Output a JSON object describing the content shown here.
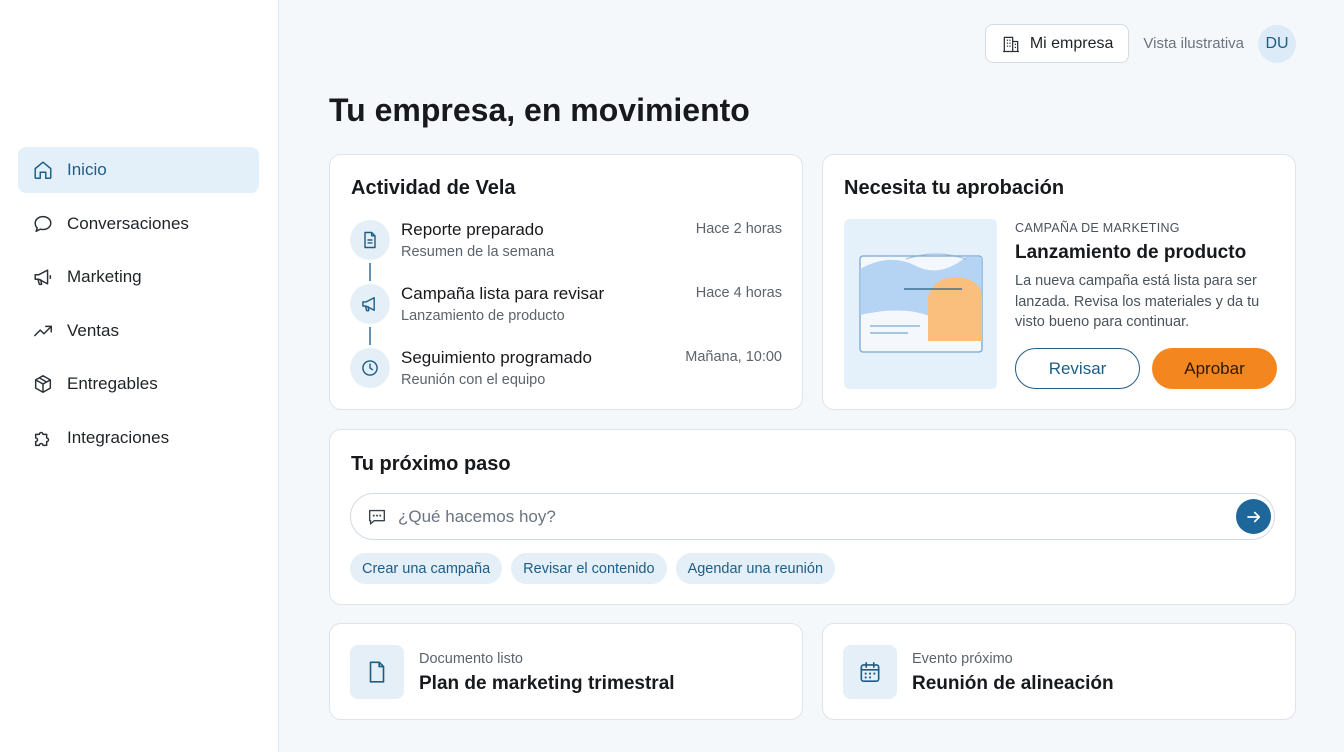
{
  "sidebar": {
    "items": [
      {
        "label": "Inicio",
        "icon": "home-icon",
        "active": true
      },
      {
        "label": "Conversaciones",
        "icon": "chat-bubble-icon"
      },
      {
        "label": "Marketing",
        "icon": "megaphone-icon"
      },
      {
        "label": "Ventas",
        "icon": "trending-up-icon"
      },
      {
        "label": "Entregables",
        "icon": "package-icon"
      },
      {
        "label": "Integraciones",
        "icon": "puzzle-icon"
      }
    ]
  },
  "header": {
    "company_label": "Mi empresa",
    "company_icon": "building-icon",
    "view_label": "Vista ilustrativa",
    "avatar_initials": "DU"
  },
  "page": {
    "title": "Tu empresa, en movimiento"
  },
  "activity": {
    "title": "Actividad de Vela",
    "items": [
      {
        "title": "Reporte preparado",
        "subtitle": "Resumen de la semana",
        "time": "Hace 2 horas",
        "icon": "document-icon"
      },
      {
        "title": "Campaña lista para revisar",
        "subtitle": "Lanzamiento de producto",
        "time": "Hace 4 horas",
        "icon": "megaphone-icon"
      },
      {
        "title": "Seguimiento programado",
        "subtitle": "Reunión con el equipo",
        "time": "Mañana, 10:00",
        "icon": "clock-icon"
      }
    ]
  },
  "approval": {
    "title": "Necesita tu aprobación",
    "kicker": "CAMPAÑA DE MARKETING",
    "item_title": "Lanzamiento de producto",
    "description": "La nueva campaña está lista para ser lanzada. Revisa los materiales y da tu visto bueno para continuar.",
    "review_label": "Revisar",
    "approve_label": "Aprobar"
  },
  "next_step": {
    "title": "Tu próximo paso",
    "placeholder": "¿Qué hacemos hoy?",
    "chips": [
      "Crear una campaña",
      "Revisar el contenido",
      "Agendar una reunión"
    ]
  },
  "tiles": {
    "doc": {
      "kicker": "Documento listo",
      "title": "Plan de marketing trimestral",
      "icon": "file-icon"
    },
    "event": {
      "kicker": "Evento próximo",
      "title": "Reunión de alineación",
      "icon": "calendar-icon"
    }
  },
  "colors": {
    "accent": "#1e5d86",
    "approve": "#f4861f",
    "active_nav_bg": "#e3f0fa",
    "page_bg": "#f5f8fb"
  }
}
